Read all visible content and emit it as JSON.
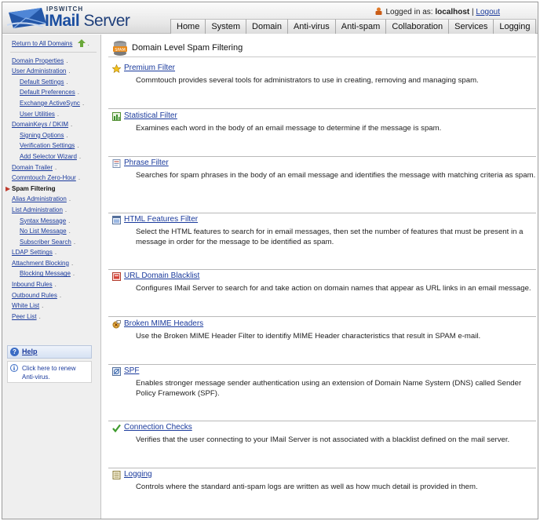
{
  "app": {
    "brand": "IPSWITCH",
    "product_prefix": "IMail",
    "product_suffix": " Server"
  },
  "login": {
    "label": "Logged in as:",
    "user": "localhost",
    "separator": "|",
    "logout": "Logout"
  },
  "topnav": [
    "Home",
    "System",
    "Domain",
    "Anti-virus",
    "Anti-spam",
    "Collaboration",
    "Services",
    "Logging"
  ],
  "sidebar": {
    "return_link": "Return to All Domains",
    "items": [
      {
        "label": "Domain Properties",
        "level": 0
      },
      {
        "label": "User Administration",
        "level": 0
      },
      {
        "label": "Default Settings",
        "level": 1
      },
      {
        "label": "Default Preferences",
        "level": 1
      },
      {
        "label": "Exchange ActiveSync",
        "level": 1
      },
      {
        "label": "User Utilities",
        "level": 1
      },
      {
        "label": "DomainKeys / DKIM",
        "level": 0
      },
      {
        "label": "Signing Options",
        "level": 1
      },
      {
        "label": "Verification Settings",
        "level": 1
      },
      {
        "label": "Add Selector Wizard",
        "level": 1
      },
      {
        "label": "Domain Trailer",
        "level": 0
      },
      {
        "label": "Commtouch Zero-Hour",
        "level": 0
      },
      {
        "label": "Spam Filtering",
        "level": 0,
        "active": true
      },
      {
        "label": "Alias Administration",
        "level": 0
      },
      {
        "label": "List Administration",
        "level": 0
      },
      {
        "label": "Syntax Message",
        "level": 1
      },
      {
        "label": "No List Message",
        "level": 1
      },
      {
        "label": "Subscriber Search",
        "level": 1
      },
      {
        "label": "LDAP Settings",
        "level": 0
      },
      {
        "label": "Attachment Blocking",
        "level": 0
      },
      {
        "label": "Blocking Message",
        "level": 1
      },
      {
        "label": "Inbound Rules",
        "level": 0
      },
      {
        "label": "Outbound Rules",
        "level": 0
      },
      {
        "label": "White List",
        "level": 0
      },
      {
        "label": "Peer List",
        "level": 0
      }
    ],
    "help": "Help",
    "renew": "Click here to renew Anti-virus."
  },
  "page": {
    "title": "Domain Level Spam Filtering"
  },
  "sections": [
    {
      "title": "Premium Filter",
      "icon": "star-icon",
      "desc": "Commtouch provides several tools for administrators to use in creating, removing and managing spam."
    },
    {
      "title": "Statistical Filter",
      "icon": "chart-icon",
      "desc": "Examines each word in the body of an email message to determine if the message is spam."
    },
    {
      "title": "Phrase Filter",
      "icon": "document-icon",
      "desc": "Searches for spam phrases in the body of an email message and identifies the message with matching criteria as spam."
    },
    {
      "title": "HTML Features Filter",
      "icon": "html-icon",
      "desc": "Select the HTML features to search for in email messages, then set the number of features that must be present in a message in order for the message to be identified as spam."
    },
    {
      "title": "URL Domain Blacklist",
      "icon": "blacklist-icon",
      "desc": "Configures IMail Server to search for and take action on domain names that appear as URL links in an email message."
    },
    {
      "title": "Broken MIME Headers",
      "icon": "broken-mime-icon",
      "desc": "Use the Broken MIME Header Filter to identifiy MIME Header characteristics that result in SPAM e-mail."
    },
    {
      "title": "SPF",
      "icon": "spf-icon",
      "desc": "Enables stronger message sender authentication using an extension of Domain Name System (DNS) called Sender Policy Framework (SPF)."
    },
    {
      "title": "Connection Checks",
      "icon": "checkmark-icon",
      "desc": "Verifies that the user connecting to your IMail Server is not associated with a blacklist defined on the mail server."
    },
    {
      "title": "Logging",
      "icon": "log-icon",
      "desc": "Controls where the standard anti-spam logs are written as well as how much detail is provided in them."
    }
  ],
  "colors": {
    "link": "#1a3a9c",
    "sidebar_bg": "#efefef",
    "logo_blue": "#1b4ea0"
  }
}
